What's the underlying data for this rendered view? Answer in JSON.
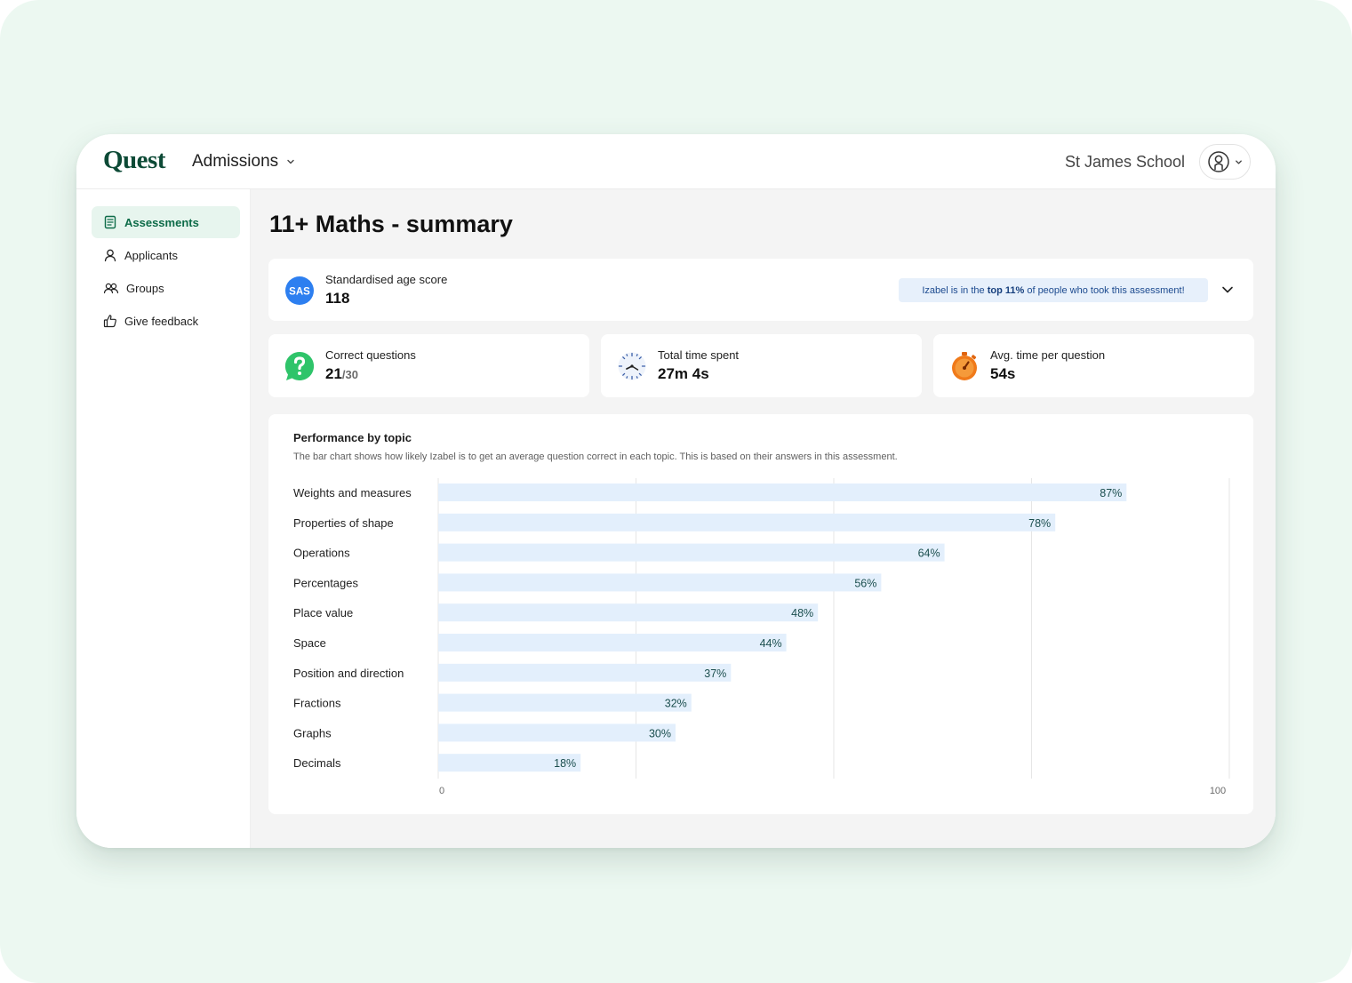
{
  "app": {
    "logo": "Quest",
    "product": "Admissions",
    "school": "St James School"
  },
  "sidebar": {
    "items": [
      {
        "label": "Assessments",
        "icon": "assessment-icon",
        "active": true
      },
      {
        "label": "Applicants",
        "icon": "user-icon",
        "active": false
      },
      {
        "label": "Groups",
        "icon": "group-icon",
        "active": false
      },
      {
        "label": "Give feedback",
        "icon": "thumbs-up-icon",
        "active": false
      }
    ]
  },
  "page": {
    "title": "11+ Maths - summary"
  },
  "sas": {
    "badge": "SAS",
    "label": "Standardised age score",
    "value": "118",
    "rank_prefix": "Izabel is in the ",
    "rank_highlight": "top 11%",
    "rank_suffix": " of people who took this assessment!"
  },
  "stats": [
    {
      "label": "Correct questions",
      "value": "21",
      "sub": "/30",
      "icon": "question-bubble-icon"
    },
    {
      "label": "Total time spent",
      "value": "27m 4s",
      "sub": "",
      "icon": "clock-icon"
    },
    {
      "label": "Avg. time per question",
      "value": "54s",
      "sub": "",
      "icon": "stopwatch-icon"
    }
  ],
  "performance": {
    "title": "Performance by topic",
    "description": "The bar chart shows how likely Izabel is to get an average question correct in each topic. This is based on their answers in this assessment."
  },
  "colors": {
    "brand": "#0d4a36",
    "active_nav_bg": "#e7f5ee",
    "bar_fill": "#e3effc",
    "bar_label": "#1b4e4e",
    "rank_banner_bg": "#e7f0fb"
  },
  "chart_data": {
    "type": "bar",
    "orientation": "horizontal",
    "categories": [
      "Weights and measures",
      "Properties of shape",
      "Operations",
      "Percentages",
      "Place value",
      "Space",
      "Position and direction",
      "Fractions",
      "Graphs",
      "Decimals"
    ],
    "values": [
      87,
      78,
      64,
      56,
      48,
      44,
      37,
      32,
      30,
      18
    ],
    "value_labels": [
      "87%",
      "78%",
      "64%",
      "56%",
      "48%",
      "44%",
      "37%",
      "32%",
      "30%",
      "18%"
    ],
    "xlim": [
      0,
      100
    ],
    "x_tick_labels": [
      "0",
      "100"
    ],
    "gridlines": [
      0,
      25,
      50,
      75,
      100
    ],
    "grid": true
  }
}
